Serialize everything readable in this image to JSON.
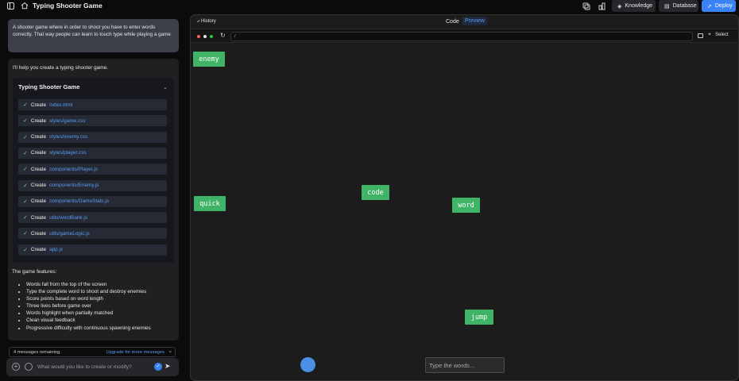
{
  "header": {
    "title": "Typing Shooter Game",
    "buttons": {
      "knowledge": "Knowledge",
      "database": "Database",
      "deploy": "Deploy"
    },
    "accent_color": "#3b82f6"
  },
  "chat": {
    "prompt": "A shooter game where in order to shoot you have to enter words correctly. That way people can learn to touch type while playing a game",
    "reply_intro": "I'll help you create a typing shooter game.",
    "artifact": {
      "title": "Typing Shooter Game",
      "files": [
        {
          "action": "Create",
          "path": "index.html"
        },
        {
          "action": "Create",
          "path": "styles/game.css"
        },
        {
          "action": "Create",
          "path": "styles/enemy.css"
        },
        {
          "action": "Create",
          "path": "styles/player.css"
        },
        {
          "action": "Create",
          "path": "components/Player.js"
        },
        {
          "action": "Create",
          "path": "components/Enemy.js"
        },
        {
          "action": "Create",
          "path": "components/GameStats.js"
        },
        {
          "action": "Create",
          "path": "utils/wordBank.js"
        },
        {
          "action": "Create",
          "path": "utils/gameLogic.js"
        },
        {
          "action": "Create",
          "path": "app.js"
        }
      ]
    },
    "features_title": "The game features:",
    "features": [
      "Words fall from the top of the screen",
      "Type the complete word to shoot and destroy enemies",
      "Score points based on word length",
      "Three lives before game over",
      "Words highlight when partially matched",
      "Clean visual feedback",
      "Progressive difficulty with continuous spawning enemies"
    ],
    "messages_remaining": "4 messages remaining.",
    "upgrade_link": "Upgrade for more messages",
    "input_placeholder": "What would you like to create or modify?"
  },
  "preview": {
    "history_label": "History",
    "tabs": {
      "code": "Code",
      "preview": "Preview"
    },
    "url": "/",
    "select_label": "Select",
    "enemy_color": "#40b466",
    "words": [
      "enemy",
      "quick",
      "code",
      "word",
      "jump"
    ],
    "type_placeholder": "Type the words..."
  }
}
